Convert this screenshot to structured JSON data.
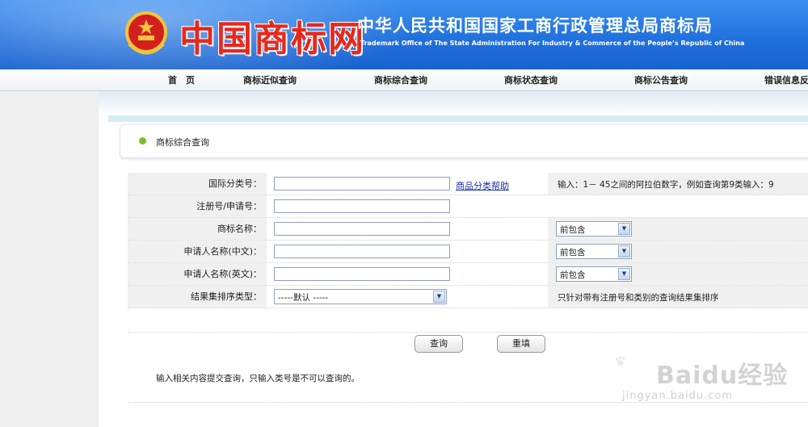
{
  "header": {
    "logo_text": "中国商标网",
    "org_cn": "中华人民共和国国家工商行政管理总局商标局",
    "org_en": "Trademark Office of The State Administration For Industry & Commerce of the People’s Republic of China"
  },
  "nav": {
    "items": [
      "首　页",
      "商标近似查询",
      "商标综合查询",
      "商标状态查询",
      "商标公告查询",
      "错误信息反"
    ]
  },
  "panel": {
    "title": "商标综合查询"
  },
  "form": {
    "rows": [
      {
        "label": "国际分类号：",
        "value": "",
        "help_link": "商品分类帮助",
        "hint": "输入：1－ 45之间的阿拉伯数字，例如查询第9类输入：9"
      },
      {
        "label": "注册号/申请号：",
        "value": ""
      },
      {
        "label": "商标名称：",
        "value": "",
        "match_option": "前包含"
      },
      {
        "label": "申请人名称(中文)：",
        "value": "",
        "match_option": "前包含"
      },
      {
        "label": "申请人名称(英文)：",
        "value": "",
        "match_option": "前包含"
      },
      {
        "label": "结果集排序类型：",
        "sort_option": "-----默认 -----",
        "hint": "只针对带有注册号和类别的查询结果集排序"
      }
    ]
  },
  "buttons": {
    "search": "查询",
    "reset": "重填"
  },
  "note": "输入相关内容提交查询，只输入类号是不可以查询的。",
  "watermark": {
    "brand": "Baidu经验",
    "url": "jingyan.baidu.com"
  },
  "colors": {
    "header_blue": "#1f6fdc",
    "title_dot": "#7dbb2b",
    "link": "#1a2ea8"
  }
}
